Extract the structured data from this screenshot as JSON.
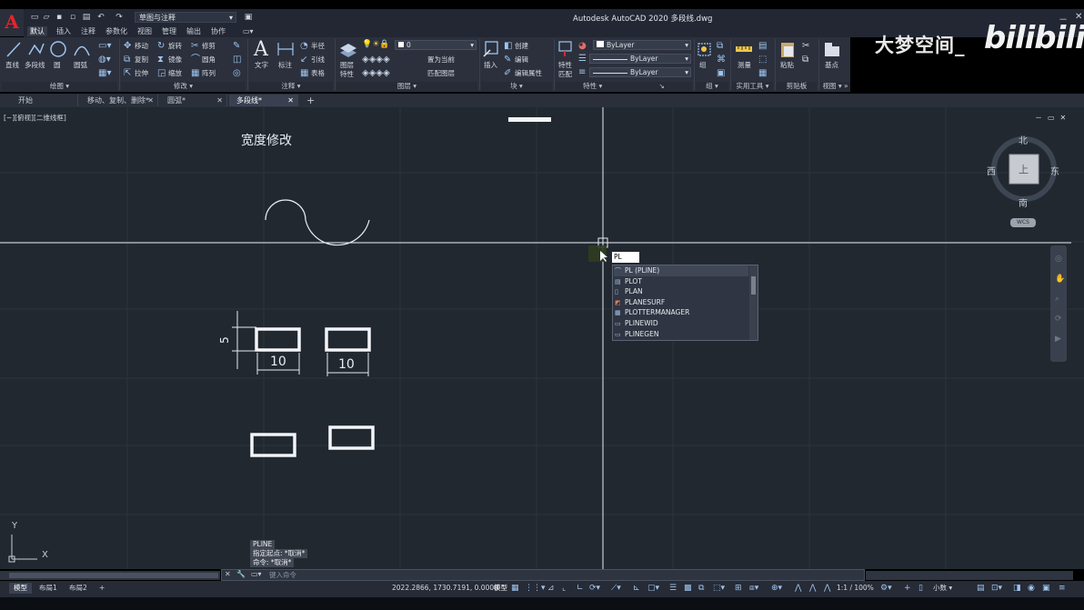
{
  "titlebar": {
    "app_letter": "A",
    "workspace": "草图与注释",
    "title": "Autodesk AutoCAD 2020    多段线.dwg",
    "win_min": "－",
    "win_max": "▭",
    "win_close": "✕"
  },
  "ribbon_tabs": [
    "默认",
    "插入",
    "注释",
    "参数化",
    "视图",
    "管理",
    "输出",
    "协作"
  ],
  "ribbon": {
    "draw": {
      "line": "直线",
      "pline": "多段线",
      "circle": "圆",
      "arc": "圆弧",
      "panel": "绘图"
    },
    "modify": {
      "move": "移动",
      "rotate": "旋转",
      "trim": "修剪",
      "copy": "复制",
      "mirror": "镜像",
      "fillet": "圆角",
      "stretch": "拉伸",
      "scale": "缩放",
      "array": "阵列",
      "panel": "修改"
    },
    "annotation": {
      "text": "文字",
      "dim": "标注",
      "radius": "半径",
      "leader": "引线",
      "table": "表格",
      "panel": "注释"
    },
    "layers": {
      "props": "图层\n特性",
      "current_layer": "0",
      "set_current": "置为当前",
      "match": "匹配图层",
      "panel": "图层"
    },
    "block": {
      "insert": "插入",
      "create": "创建",
      "edit": "编辑",
      "edit_attr": "编辑属性",
      "panel": "块"
    },
    "properties": {
      "match": "特性\n匹配",
      "color": "ByLayer",
      "linetype": "ByLayer",
      "lineweight": "ByLayer",
      "panel": "特性"
    },
    "groups": {
      "group": "组",
      "panel": "组"
    },
    "utilities": {
      "measure": "测量",
      "panel": "实用工具"
    },
    "clipboard": {
      "paste": "粘贴",
      "panel": "剪贴板"
    },
    "view": {
      "base": "基点",
      "panel": "视图"
    }
  },
  "watermark": {
    "channel": "大梦空间_",
    "site": "bilibili"
  },
  "file_tabs": [
    {
      "label": "开始",
      "active": false
    },
    {
      "label": "移动、复制、删除*",
      "active": false
    },
    {
      "label": "圆弧*",
      "active": false
    },
    {
      "label": "多段线*",
      "active": true
    }
  ],
  "drawing": {
    "view_label": "[−][俯视][二维线框]",
    "heading": "宽度修改",
    "dim_height": "5",
    "dim_width_1": "10",
    "dim_width_2": "10",
    "ucs_x": "X",
    "ucs_y": "Y"
  },
  "viewcube": {
    "north": "北",
    "south": "南",
    "east": "东",
    "west": "西",
    "top": "上",
    "wcs": "WCS"
  },
  "autocomplete": {
    "typed": "PL",
    "items": [
      {
        "label": "PL (PLINE)",
        "icon": "pline-icon"
      },
      {
        "label": "PLOT",
        "icon": "plot-icon"
      },
      {
        "label": "PLAN",
        "icon": "plan-icon"
      },
      {
        "label": "PLANESURF",
        "icon": "planesurf-icon"
      },
      {
        "label": "PLOTTERMANAGER",
        "icon": "plottermanager-icon"
      },
      {
        "label": "PLINEWID",
        "icon": "plinewid-icon"
      },
      {
        "label": "PLINEGEN",
        "icon": "plinegen-icon"
      }
    ]
  },
  "command_history": [
    "PLINE",
    "指定起点: *取消*",
    "命令: *取消*"
  ],
  "command_line": {
    "placeholder": "键入命令"
  },
  "status": {
    "layout_tabs": [
      "模型",
      "布局1",
      "布局2"
    ],
    "coords": "2022.2866, 1730.7191, 0.0000",
    "model": "模型",
    "scale": "1:1 / 100%",
    "units": "小数"
  },
  "colors": {
    "canvas": "#212830",
    "ribbon": "#2b303c",
    "accent_red": "#e8232a",
    "crosshair": "#e8ecf2"
  }
}
